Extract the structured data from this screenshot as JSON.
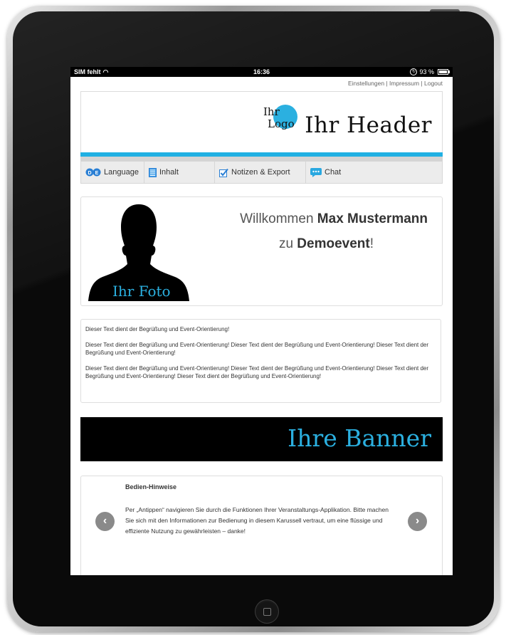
{
  "statusbar": {
    "carrier": "SIM fehlt",
    "time": "16:36",
    "battery": "93 %"
  },
  "toplinks": {
    "settings": "Einstellungen",
    "sep": " | ",
    "imprint": "Impressum",
    "logout": "Logout"
  },
  "header": {
    "logo_line1": "Ihr",
    "logo_line2": "Logo",
    "title": "Ihr Header"
  },
  "nav": [
    {
      "label": "Language",
      "icon": "language-flags-icon"
    },
    {
      "label": "Inhalt",
      "icon": "document-icon"
    },
    {
      "label": "Notizen & Export",
      "icon": "checkbox-icon"
    },
    {
      "label": "Chat",
      "icon": "chat-bubble-icon"
    }
  ],
  "welcome": {
    "photo_label": "Ihr Foto",
    "line1_prefix": "Willkommen ",
    "user_name": "Max Mustermann",
    "line2_prefix": "zu ",
    "event_name": "Demoevent",
    "line2_suffix": "!"
  },
  "intro_text": {
    "p1": "Dieser Text dient der Begrüßung und Event-Orientierung!",
    "p2": "Dieser Text dient der Begrüßung und Event-Orientierung! Dieser Text dient der Begrüßung und Event-Orientierung! Dieser Text dient der Begrüßung und Event-Orientierung!",
    "p3": "Dieser Text dient der Begrüßung und Event-Orientierung! Dieser Text dient der Begrüßung und Event-Orientierung! Dieser Text dient der Begrüßung und Event-Orientierung! Dieser Text dient der Begrüßung und Event-Orientierung!"
  },
  "banner": {
    "text": "Ihre Banner"
  },
  "hints": {
    "title": "Bedien-Hinweise",
    "text": "Per „Antippen“ navigieren Sie durch die Funktionen Ihrer Veranstaltungs-Applikation. Bitte machen Sie sich mit den Informationen zur Bedienung in diesem Karussell vertraut, um eine flüssige und effiziente Nutzung zu gewährleisten – danke!",
    "prev_icon": "‹",
    "next_icon": "›"
  },
  "colors": {
    "accent": "#20b0e3",
    "banner_bg": "#000000"
  }
}
